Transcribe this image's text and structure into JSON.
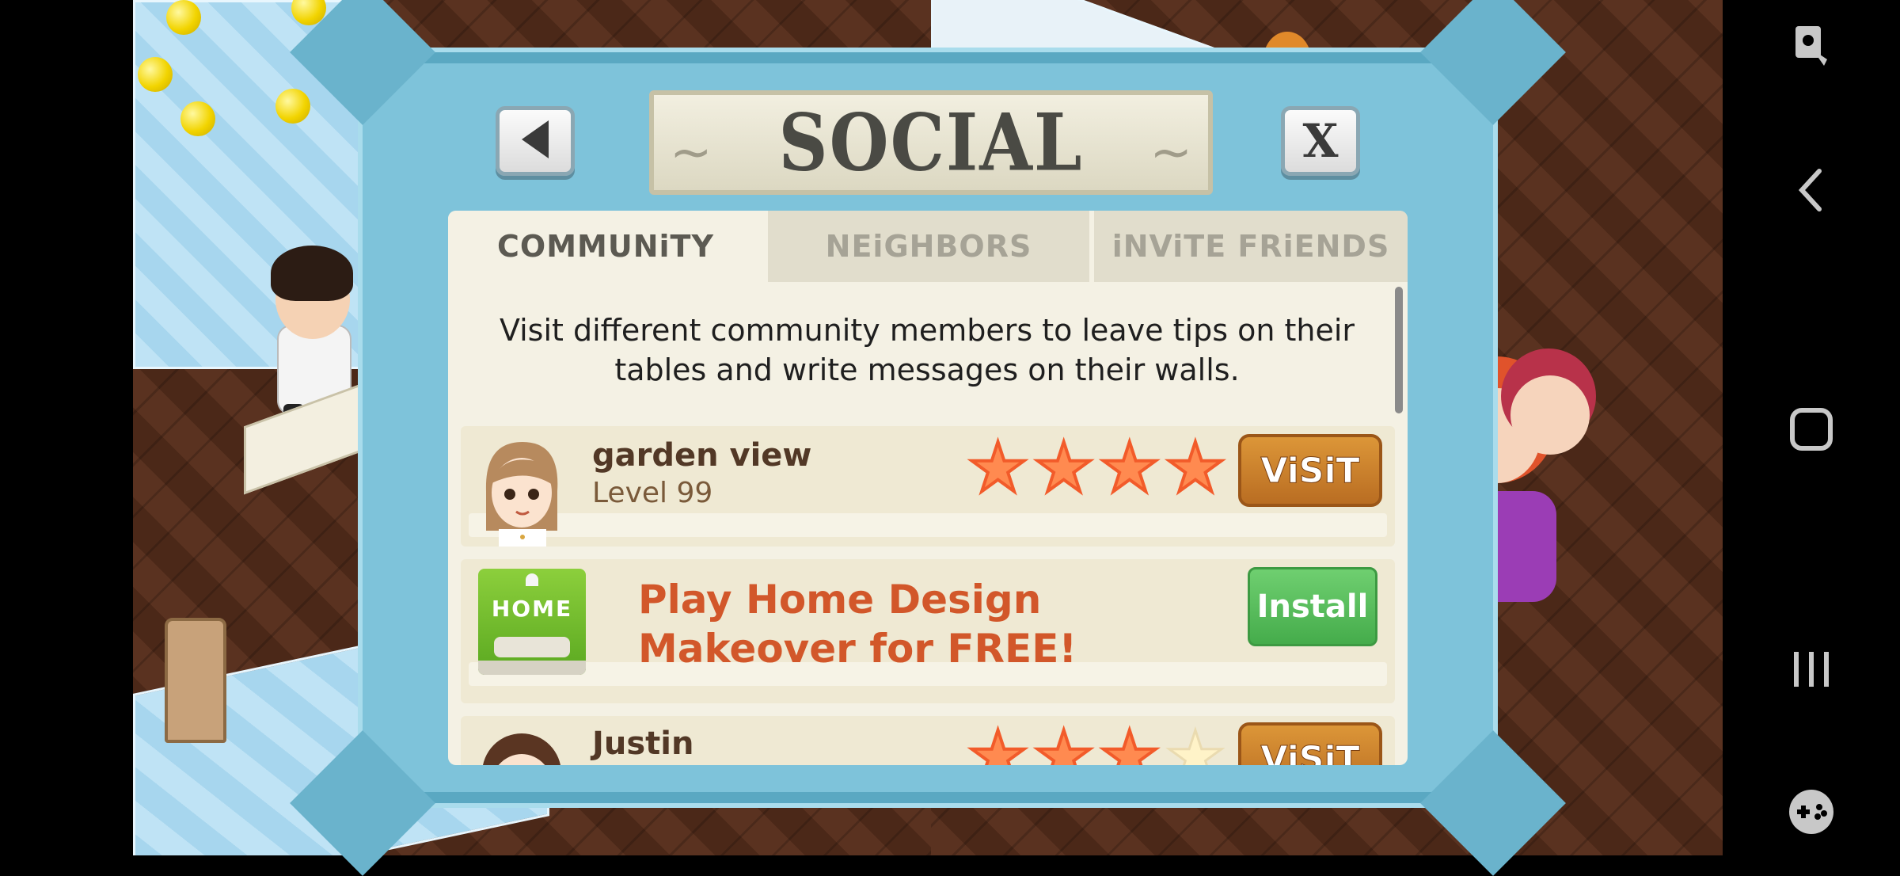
{
  "dialog": {
    "title": "SOCIAL",
    "back_icon": "triangle-left-icon",
    "close_label": "X"
  },
  "tabs": [
    {
      "label": "COMMUNiTY",
      "active": true
    },
    {
      "label": "NEiGHBORS",
      "active": false
    },
    {
      "label": "iNViTE FRiENDS",
      "active": false
    }
  ],
  "intro": "Visit different community members to leave tips on their tables and write messages on their walls.",
  "members": [
    {
      "name": "garden view",
      "level": "Level 99",
      "stars": 4,
      "max_stars": 4,
      "button": "ViSiT"
    },
    {
      "name": "Justin",
      "level": "",
      "stars": 3,
      "max_stars": 4,
      "button": "ViSiT"
    }
  ],
  "ad": {
    "text": "Play Home Design Makeover for FREE!",
    "image_label": "HOME",
    "button": "Install"
  },
  "colors": {
    "accent_orange": "#d2572a",
    "visit_button": "#c57b2a",
    "install_button": "#55bb5a",
    "dialog_frame": "#7ec3da"
  },
  "nav_icons": [
    "screen-lock-icon",
    "back-chevron-icon",
    "home-square-icon",
    "recent-apps-icon",
    "game-controller-icon"
  ]
}
